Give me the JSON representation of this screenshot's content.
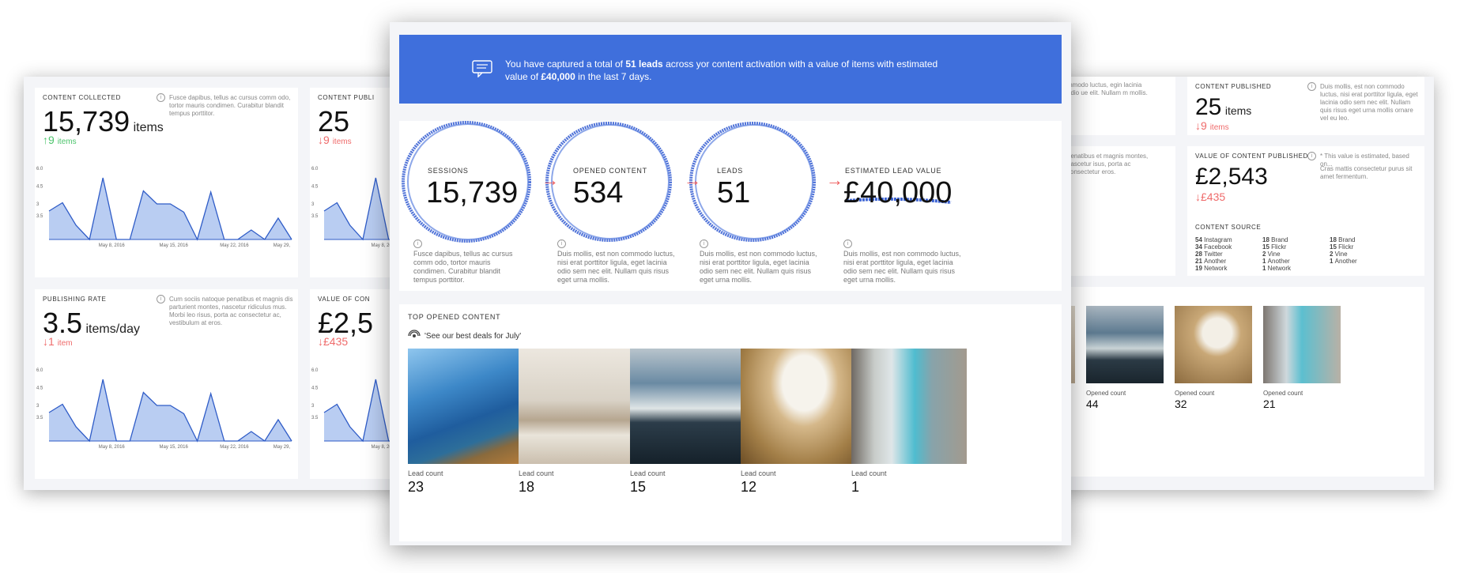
{
  "left": {
    "content_collected": {
      "label": "CONTENT COLLECTED",
      "value": "15,739",
      "unit": "items",
      "delta": "9",
      "delta_unit": "items",
      "description": "Fusce dapibus, tellus ac cursus comm odo, tortor mauris condimen. Curabitur blandit tempus porttitor."
    },
    "publishing_rate": {
      "label": "PUBLISHING RATE",
      "value": "3.5",
      "unit": "items/day",
      "delta": "1",
      "delta_unit": "item",
      "description": "Cum sociis natoque penatibus et magnis dis parturient montes, nascetur ridiculus mus. Morbi leo risus, porta ac consectetur ac, vestibulum at eros."
    },
    "content_published_partial": {
      "label": "CONTENT PUBLI",
      "value": "25",
      "delta": "9",
      "delta_unit": "items"
    },
    "value_partial": {
      "label": "VALUE OF CON",
      "value": "£2,5",
      "delta": "£435"
    }
  },
  "chart_data": [
    {
      "type": "area",
      "x": [
        "May 8, 2016",
        "May 15, 2016",
        "May 22, 2016",
        "May 29,"
      ],
      "y_ticks": [
        "6.0",
        "4.5",
        "3",
        "3.5"
      ],
      "values": [
        2.4,
        3.1,
        1.2,
        0,
        5.2,
        0,
        0,
        4.1,
        3,
        3,
        2.3,
        0,
        4.0,
        0,
        0,
        0.8,
        0,
        1.8,
        0
      ]
    },
    {
      "type": "area",
      "x": [
        "May 8, 2016",
        "May 15, 2016",
        "May 22, 2016",
        "May 29,"
      ],
      "y_ticks": [
        "6.0",
        "4.5",
        "3",
        "3.5"
      ],
      "values": [
        2.4,
        3.1,
        1.2,
        0,
        5.2,
        0,
        0,
        4.1,
        3,
        3,
        2.3,
        0,
        4.0,
        0,
        0,
        0.8,
        0,
        1.8,
        0
      ]
    }
  ],
  "banner": {
    "text_a": "You have captured a total of",
    "leads_bold": "51 leads",
    "text_b": "across yor content activation  with a value of items with estimated value of",
    "value_bold": "£40,000",
    "text_c": "in the last 7 days."
  },
  "funnel": [
    {
      "label": "SESSIONS",
      "value": "15,739",
      "description": "Fusce dapibus, tellus ac cursus comm odo, tortor mauris condimen. Curabitur blandit tempus porttitor."
    },
    {
      "label": "OPENED CONTENT",
      "value": "534",
      "description": "Duis mollis, est non commodo luctus, nisi erat porttitor ligula, eget lacinia odio sem nec elit. Nullam quis risus eget urna mollis."
    },
    {
      "label": "LEADS",
      "value": "51",
      "description": "Duis mollis, est non commodo luctus, nisi erat porttitor ligula, eget lacinia odio sem nec elit. Nullam quis risus eget urna mollis."
    },
    {
      "label": "ESTIMATED LEAD VALUE",
      "value": "£40,000",
      "description": "Duis mollis, est non commodo luctus, nisi erat porttitor ligula, eget lacinia odio sem nec elit. Nullam quis risus eget urna mollis."
    }
  ],
  "top_content": {
    "title": "TOP OPENED CONTENT",
    "campaign": "'See our best deals for July'",
    "caption": "Lead count",
    "items": [
      {
        "value": "23",
        "image": "coastal-cliff"
      },
      {
        "value": "18",
        "image": "bedroom-interior"
      },
      {
        "value": "15",
        "image": "sea-sunset-boat"
      },
      {
        "value": "12",
        "image": "hat-on-book"
      },
      {
        "value": "1",
        "image": "pool-terrace-room"
      }
    ]
  },
  "right": {
    "partial_desc_1": "mmodo luctus, egin lacinia odio ue elit. Nullam m mollis.",
    "content_published": {
      "label": "CONTENT PUBLISHED",
      "value": "25",
      "unit": "items",
      "delta": "9",
      "delta_unit": "items",
      "description": "Duis mollis, est non commodo luctus, nisi erat porttitor ligula, eget lacinia odio sem nec elit. Nullam quis risus eget urna mollis ornare vel eu leo."
    },
    "partial_desc_2": "penatibus et magnis montes, nascetur isus, porta ac consectetur eros.",
    "value_published": {
      "label": "VALUE OF CONTENT PUBLISHED",
      "value": "£2,543",
      "delta": "£435",
      "description_a": "* This value is estimated, based on...",
      "description_b": "Cras mattis consectetur purus sit amet fermentum."
    },
    "content_source": {
      "label": "CONTENT SOURCE",
      "columns": [
        [
          {
            "n": "54",
            "t": "Instagram"
          },
          {
            "n": "34",
            "t": "Facebook"
          },
          {
            "n": "28",
            "t": "Twitter"
          },
          {
            "n": "21",
            "t": "Another"
          },
          {
            "n": "19",
            "t": "Network"
          }
        ],
        [
          {
            "n": "18",
            "t": "Brand"
          },
          {
            "n": "15",
            "t": "Flickr"
          },
          {
            "n": "2",
            "t": "Vine"
          },
          {
            "n": "1",
            "t": "Another"
          },
          {
            "n": "1",
            "t": "Network"
          }
        ],
        [
          {
            "n": "18",
            "t": "Brand"
          },
          {
            "n": "15",
            "t": "Flickr"
          },
          {
            "n": "2",
            "t": "Vine"
          },
          {
            "n": "1",
            "t": "Another"
          }
        ]
      ]
    },
    "opened": {
      "caption": "Opened count",
      "values": [
        "44",
        "32",
        "21"
      ]
    }
  }
}
